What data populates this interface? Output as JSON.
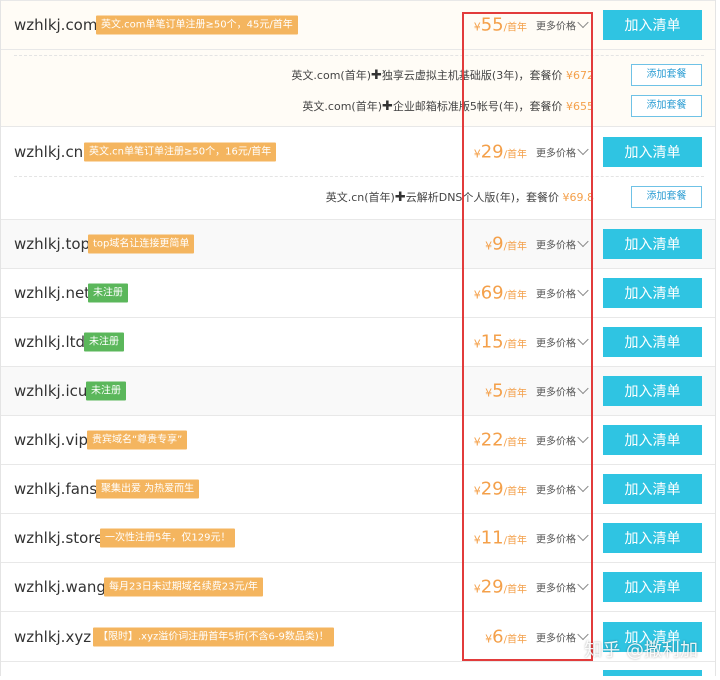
{
  "add_label": "加入清单",
  "more_label": "更多价格",
  "price_unit": "/首年",
  "currency": "¥",
  "package_button_label": "添加套餐",
  "rows": [
    {
      "domain": "wzhlkj.com",
      "badge": "英文.com单笔订单注册≥50个，45元/首年",
      "badge_color": "orange",
      "price": "55"
    },
    {
      "domain": "wzhlkj.cn",
      "badge": "英文.cn单笔订单注册≥50个，16元/首年",
      "badge_color": "orange",
      "price": "29"
    },
    {
      "domain": "wzhlkj.top",
      "badge": "top域名让连接更简单",
      "badge_color": "orange",
      "price": "9"
    },
    {
      "domain": "wzhlkj.net",
      "badge": "未注册",
      "badge_color": "green",
      "price": "69"
    },
    {
      "domain": "wzhlkj.ltd",
      "badge": "未注册",
      "badge_color": "green",
      "price": "15"
    },
    {
      "domain": "wzhlkj.icu",
      "badge": "未注册",
      "badge_color": "green",
      "price": "5"
    },
    {
      "domain": "wzhlkj.vip",
      "badge": "贵宾域名“尊贵专享”",
      "badge_color": "orange",
      "price": "22"
    },
    {
      "domain": "wzhlkj.fans",
      "badge": "聚集出爱 为热爱而生",
      "badge_color": "orange",
      "price": "29"
    },
    {
      "domain": "wzhlkj.store",
      "badge": "一次性注册5年，仅129元！",
      "badge_color": "orange",
      "price": "11"
    },
    {
      "domain": "wzhlkj.wang",
      "badge": "每月23日未过期域名续费23元/年",
      "badge_color": "orange",
      "price": "29"
    },
    {
      "domain": "wzhlkj.xyz",
      "badge": "【限时】.xyz溢价词注册首年5折(不含6-9数品类)！",
      "badge_color": "orange",
      "price": "6"
    }
  ],
  "packages": [
    {
      "part1": "英文.com(首年)",
      "plus": "✚",
      "part2": "独享云虚拟主机基础版(3年)，套餐价",
      "price": "¥672"
    },
    {
      "part1": "英文.com(首年)",
      "plus": "✚",
      "part2": "企业邮箱标准版5帐号(年)，套餐价",
      "price": "¥655"
    },
    {
      "part1": "英文.cn(首年)",
      "plus": "✚",
      "part2": "云解析DNS个人版(年)，套餐价",
      "price": "¥69.8"
    }
  ],
  "watermark": "知乎 @撒利加",
  "colors": {
    "accent": "#2fc4e2",
    "price": "#f4a04a",
    "highlight": "#e23b3b",
    "badge_orange": "#f4b55f",
    "badge_green": "#5bb75b"
  }
}
